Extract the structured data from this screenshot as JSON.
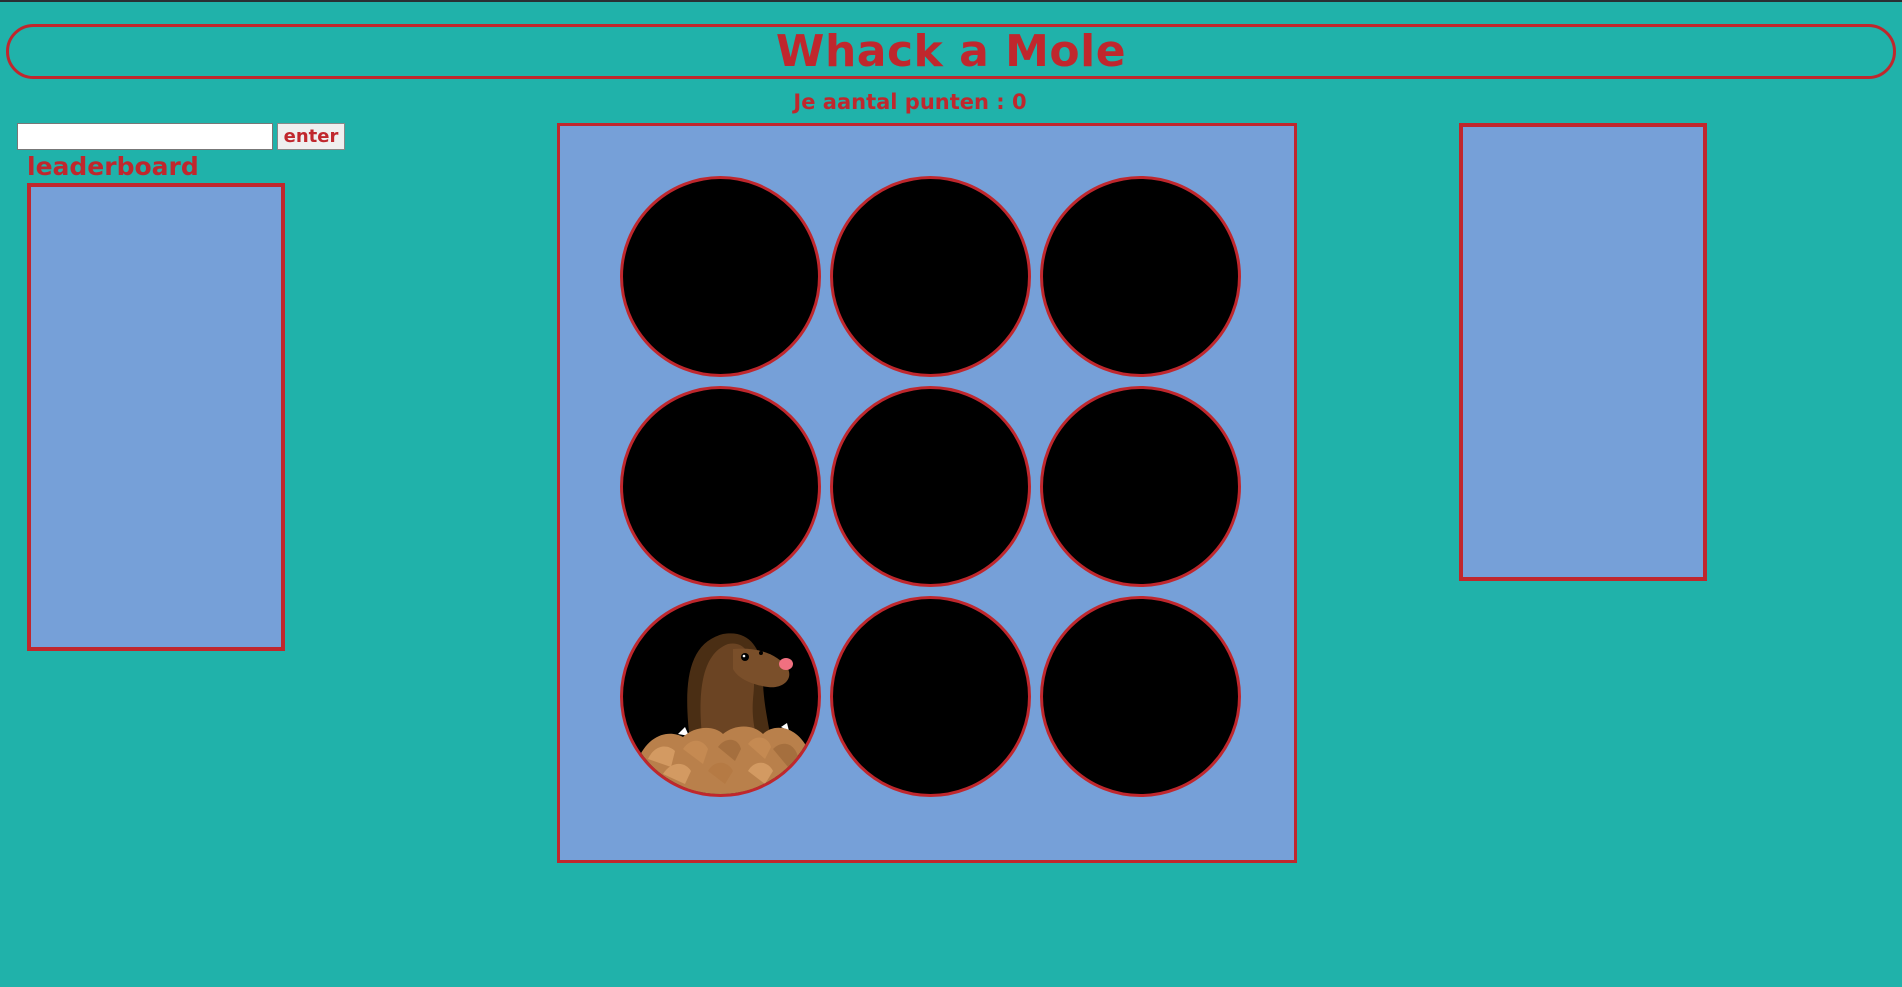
{
  "header": {
    "title": "Whack a Mole"
  },
  "score": {
    "text": "Je aantal punten : 0"
  },
  "name_form": {
    "input_value": "",
    "input_placeholder": "",
    "button_label": "enter"
  },
  "leaderboard": {
    "title": "leaderboard",
    "entries": []
  },
  "board": {
    "holes": [
      {
        "mole": false
      },
      {
        "mole": false
      },
      {
        "mole": false
      },
      {
        "mole": false
      },
      {
        "mole": false
      },
      {
        "mole": false
      },
      {
        "mole": true
      },
      {
        "mole": false
      },
      {
        "mole": false
      }
    ]
  },
  "colors": {
    "background": "#20b2aa",
    "accent": "#c0272d",
    "panel": "#76a0d8",
    "hole": "#000000"
  }
}
